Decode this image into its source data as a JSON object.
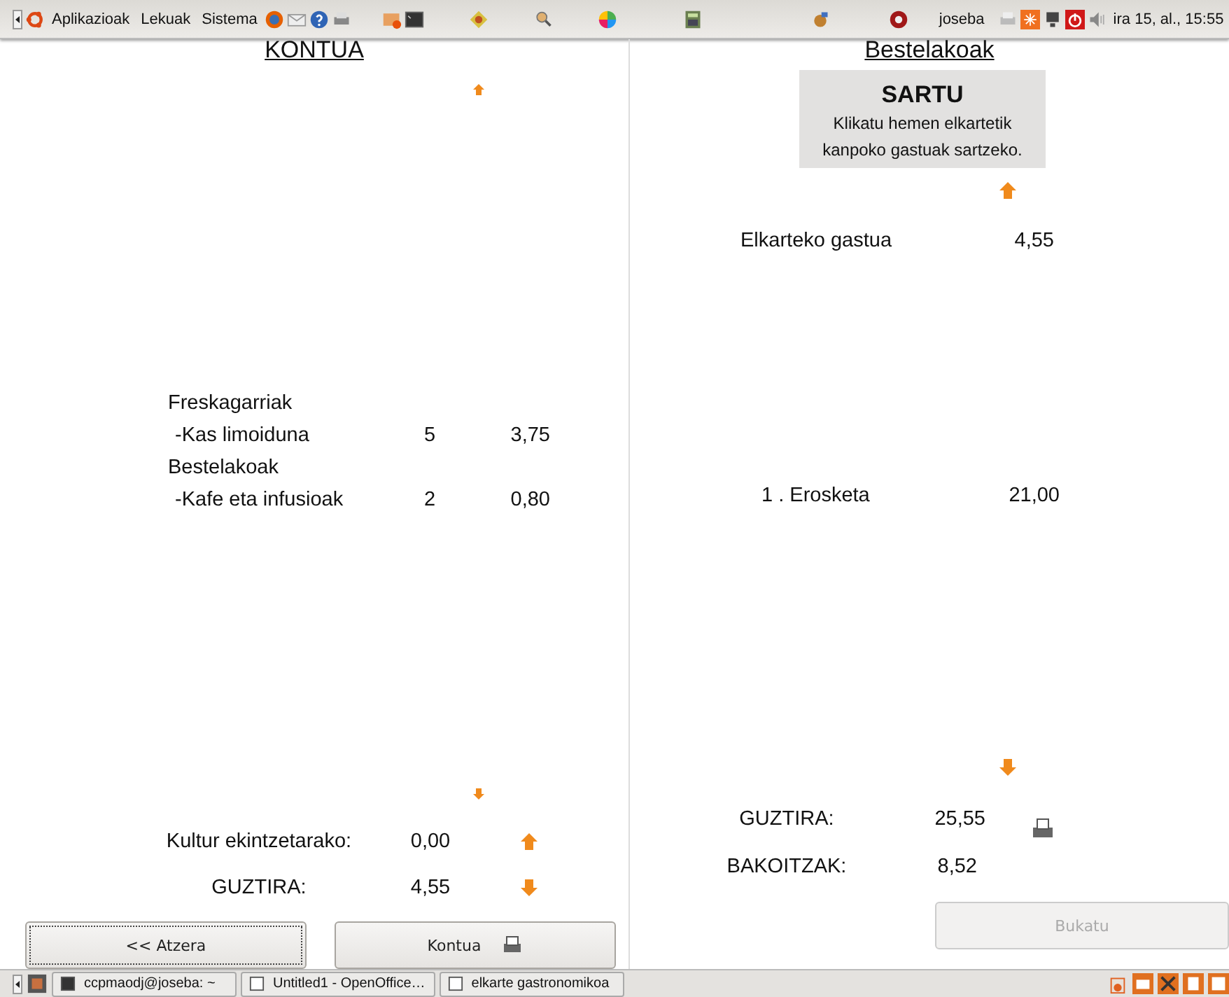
{
  "top_panel": {
    "menus": [
      "Aplikazioak",
      "Lekuak",
      "Sistema"
    ],
    "user": "joseba",
    "clock": "ira 15, al., 15:55"
  },
  "left": {
    "title": "KONTUA",
    "items": [
      {
        "kind": "group",
        "name": "Freskagarriak"
      },
      {
        "kind": "item",
        "name": "-Kas limoiduna",
        "qty": "5",
        "price": "3,75"
      },
      {
        "kind": "group",
        "name": "Bestelakoak"
      },
      {
        "kind": "item",
        "name": "-Kafe eta infusioak",
        "qty": "2",
        "price": "0,80"
      }
    ],
    "culture": {
      "label": "Kultur ekintzetarako:",
      "value": "0,00"
    },
    "total": {
      "label": "GUZTIRA:",
      "value": "4,55"
    }
  },
  "right": {
    "title": "Bestelakoak",
    "enter_box": {
      "title": "SARTU",
      "description": "Klikatu hemen elkartetik kanpoko gastuak sartzeko."
    },
    "club_expense": {
      "label": "Elkarteko gastua",
      "value": "4,55"
    },
    "purchase": {
      "label": "1 . Erosketa",
      "value": "21,00"
    },
    "total": {
      "label": "GUZTIRA:",
      "value": "25,55"
    },
    "each": {
      "label": "BAKOITZAK:",
      "value": "8,52"
    }
  },
  "buttons": [
    {
      "label": "<< Atzera",
      "disabled": false,
      "focused": true,
      "printer": false
    },
    {
      "label": "Kontua",
      "disabled": false,
      "focused": false,
      "printer": true
    },
    {
      "label": "Bukatu",
      "disabled": true,
      "focused": false,
      "printer": false
    }
  ],
  "taskbar": [
    "ccpmaodj@joseba: ~",
    "Untitled1 - OpenOffice…",
    "elkarte gastronomikoa"
  ]
}
